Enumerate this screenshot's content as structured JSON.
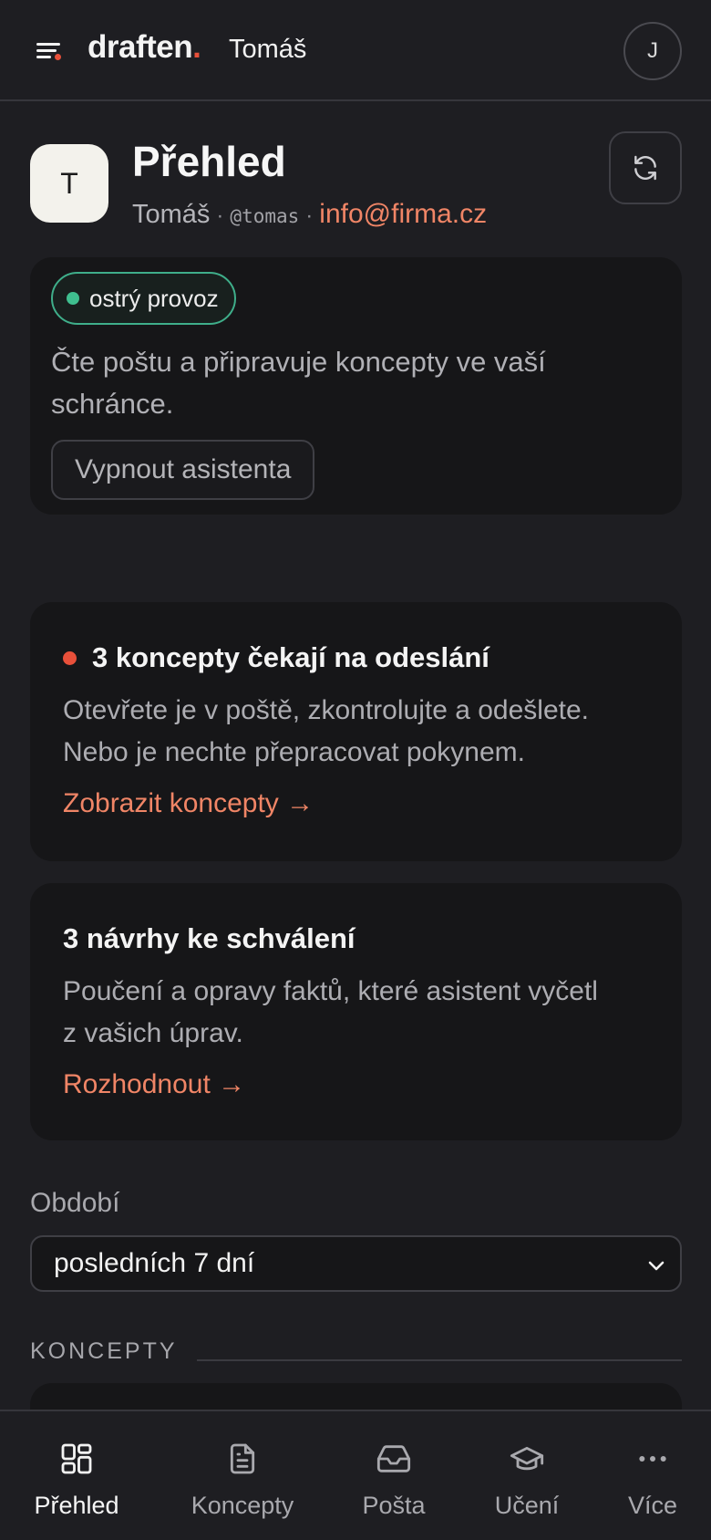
{
  "topbar": {
    "brand_name": "draften",
    "brand_dot": ".",
    "user_name": "Tomáš",
    "avatar_initial": "J"
  },
  "profile": {
    "avatar_initial": "T",
    "title": "Přehled",
    "name": "Tomáš",
    "separator": "·",
    "handle": "@tomas",
    "email": "info@firma.cz"
  },
  "status": {
    "badge": "ostrý provoz",
    "description": "Čte poštu a připravuje koncepty ve vaší schránce.",
    "toggle_button": "Vypnout asistenta"
  },
  "alerts": [
    {
      "title": "3 koncepty čekají na odeslání",
      "line1": "Otevřete je v poště, zkontrolujte a odešlete.",
      "line2": "Nebo je nechte přepracovat pokynem.",
      "link": "Zobrazit koncepty →"
    },
    {
      "title": "3 návrhy ke schválení",
      "line1": "Poučení a opravy faktů, které asistent vyčetl",
      "line2": "z vašich úprav.",
      "link": "Rozhodnout →"
    }
  ],
  "period": {
    "label": "Období",
    "selected": "posledních 7 dní"
  },
  "section": {
    "label": "KONCEPTY"
  },
  "nav": {
    "items": [
      {
        "label": "Přehled",
        "icon": "dashboard-icon",
        "active": true
      },
      {
        "label": "Koncepty",
        "icon": "document-icon",
        "active": false
      },
      {
        "label": "Pošta",
        "icon": "inbox-icon",
        "active": false
      },
      {
        "label": "Učení",
        "icon": "graduation-cap-icon",
        "active": false
      },
      {
        "label": "Více",
        "icon": "more-dots-icon",
        "active": false
      }
    ]
  },
  "colors": {
    "background": "#1e1e22",
    "card": "#161618",
    "accent": "#f08566",
    "brand_dot": "#e8503a",
    "live_green": "#3fbf8f"
  }
}
